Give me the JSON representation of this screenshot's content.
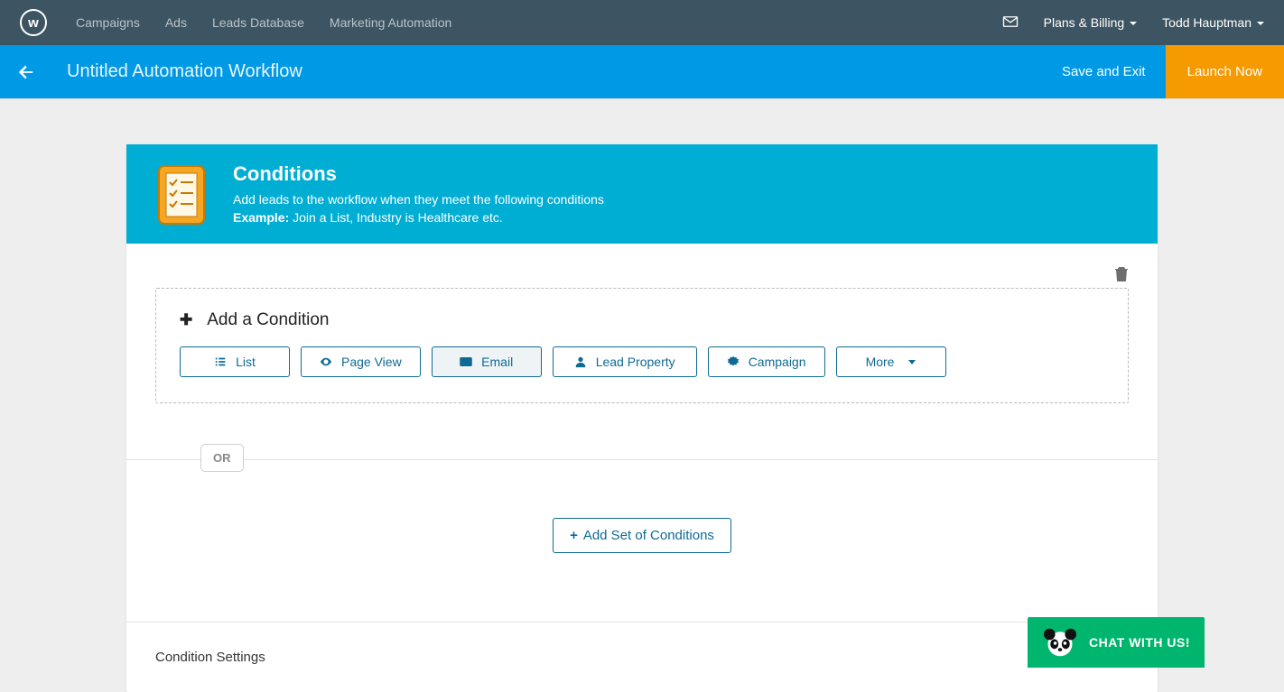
{
  "nav": {
    "logo_letter": "w",
    "items": [
      "Campaigns",
      "Ads",
      "Leads Database",
      "Marketing Automation"
    ],
    "plans_label": "Plans & Billing",
    "user_name": "Todd Hauptman"
  },
  "subheader": {
    "title": "Untitled Automation Workflow",
    "save_label": "Save and Exit",
    "launch_label": "Launch Now"
  },
  "conditions_card": {
    "title": "Conditions",
    "subtitle": "Add leads to the workflow when they meet the following conditions",
    "example_label": "Example:",
    "example_text": " Join a List, Industry is Healthcare etc.",
    "add_condition_label": "Add a Condition",
    "pills": {
      "list": "List",
      "page_view": "Page View",
      "email": "Email",
      "lead_property": "Lead Property",
      "campaign": "Campaign",
      "more": "More"
    },
    "or_label": "OR",
    "add_set_label": "Add Set of Conditions",
    "settings_label": "Condition Settings"
  },
  "chat": {
    "label": "CHAT WITH US!"
  }
}
